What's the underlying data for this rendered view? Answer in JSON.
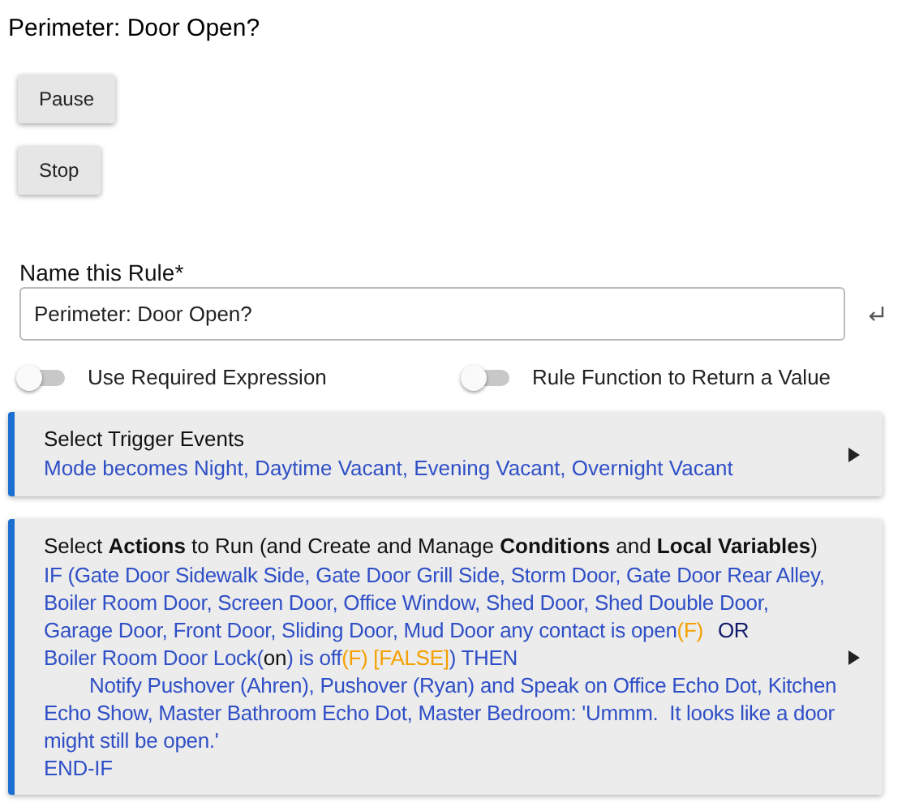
{
  "page_title": "Perimeter: Door Open?",
  "buttons": [
    {
      "label": "Pause"
    },
    {
      "label": "Stop"
    }
  ],
  "name_field": {
    "label": "Name this Rule*",
    "value": "Perimeter: Door Open?"
  },
  "toggles": [
    {
      "label": "Use Required Expression",
      "on": false
    },
    {
      "label": "Rule Function to Return a Value",
      "on": false
    }
  ],
  "trigger_section": {
    "title": "Select Trigger Events",
    "summary": "Mode becomes Night, Daytime Vacant, Evening Vacant, Overnight Vacant"
  },
  "actions_section": {
    "title": "Select **Actions** to Run (and Create and Manage **Conditions** and **Local Variables**)",
    "lines": [
      {
        "indent": false,
        "segments": [
          {
            "kind": "text",
            "text": "IF (Gate Door Sidewalk Side, Gate Door Grill Side, Storm Door, Gate Door Rear Alley,"
          }
        ]
      },
      {
        "indent": false,
        "segments": [
          {
            "kind": "text",
            "text": "Boiler Room Door, Screen Door, Office Window, Shed Door, Shed Double Door,"
          }
        ]
      },
      {
        "indent": false,
        "segments": [
          {
            "kind": "text",
            "text": "Garage Door, Front Door, Sliding Door, Mud Door any contact is open"
          },
          {
            "kind": "result",
            "text": "(F)"
          },
          {
            "kind": "operator",
            "text": "OR"
          }
        ]
      },
      {
        "indent": false,
        "segments": [
          {
            "kind": "text",
            "text": "Boiler Room Door Lock("
          },
          {
            "kind": "value",
            "text": "on"
          },
          {
            "kind": "text",
            "text": ") is off"
          },
          {
            "kind": "result",
            "text": "(F) [FALSE]"
          },
          {
            "kind": "text",
            "text": ") THEN"
          }
        ]
      },
      {
        "indent": true,
        "segments": [
          {
            "kind": "text",
            "text": "Notify Pushover (Ahren), Pushover (Ryan) and Speak on Office Echo Dot, Kitchen"
          }
        ]
      },
      {
        "indent": false,
        "segments": [
          {
            "kind": "text",
            "text": "Echo Show, Master Bathroom Echo Dot, Master Bedroom: 'Ummm.  It looks like a door"
          }
        ]
      },
      {
        "indent": false,
        "segments": [
          {
            "kind": "text",
            "text": "might still be open.'"
          }
        ]
      },
      {
        "indent": false,
        "segments": [
          {
            "kind": "text",
            "text": "END-IF"
          }
        ]
      }
    ]
  }
}
